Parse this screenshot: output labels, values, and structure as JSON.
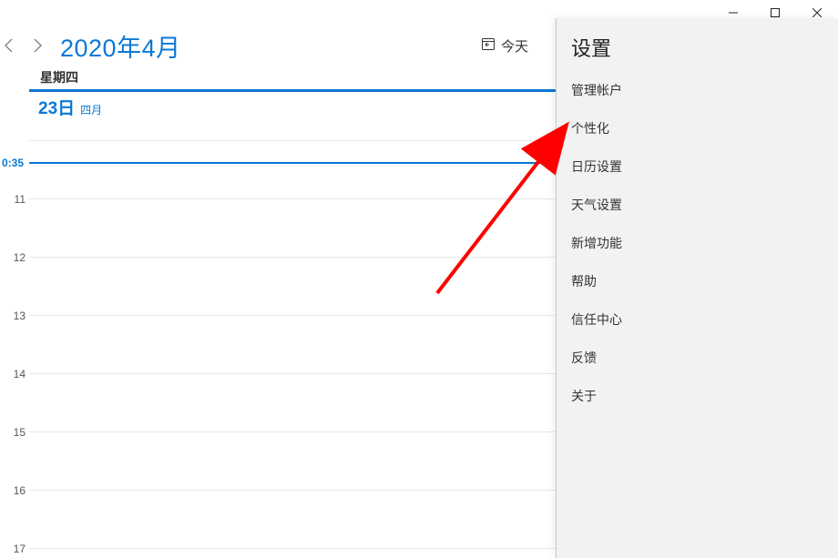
{
  "titlebar": {},
  "header": {
    "title": "2020年4月",
    "today": "今天"
  },
  "dayhdr": {
    "weekday": "星期四"
  },
  "dateinfo": {
    "day": "23日",
    "month": "四月"
  },
  "timeline": {
    "now_label": "0:35",
    "hours": [
      "11",
      "12",
      "13",
      "14",
      "15",
      "16",
      "17"
    ]
  },
  "settings": {
    "title": "设置",
    "items": [
      "管理帐户",
      "个性化",
      "日历设置",
      "天气设置",
      "新增功能",
      "帮助",
      "信任中心",
      "反馈",
      "关于"
    ]
  }
}
